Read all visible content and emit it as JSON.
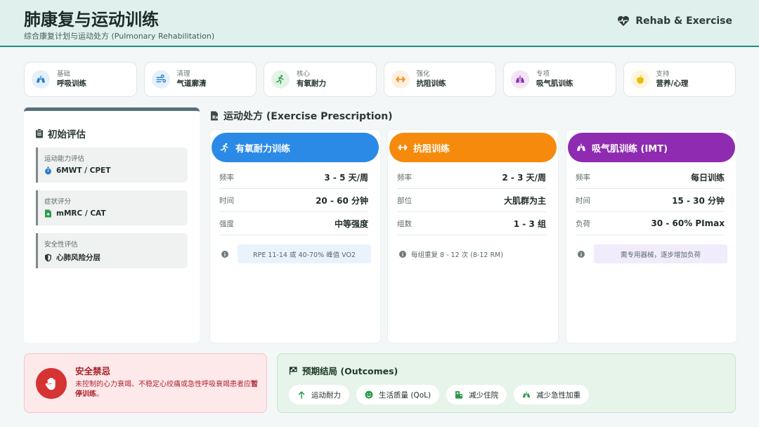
{
  "header": {
    "title": "肺康复与运动训练",
    "subtitle": "综合康复计划与运动处方 (Pulmonary Rehabilitation)",
    "brand": "Rehab & Exercise",
    "brand_icon": "heartbeat-icon"
  },
  "steps": [
    {
      "caption": "基础",
      "label": "呼吸训练",
      "icon": "lungs-icon",
      "color": "#2f80c8",
      "bg": "#e4f0fb"
    },
    {
      "caption": "清理",
      "label": "气道廓清",
      "icon": "wind-icon",
      "color": "#2f80c8",
      "bg": "#e4f0fb"
    },
    {
      "caption": "核心",
      "label": "有氧耐力",
      "icon": "running-icon",
      "color": "#2e9a4a",
      "bg": "#e3f4e6"
    },
    {
      "caption": "强化",
      "label": "抗阻训练",
      "icon": "dumbbell-icon",
      "color": "#f08a12",
      "bg": "#fdf0e0"
    },
    {
      "caption": "专项",
      "label": "吸气肌训练",
      "icon": "lungs-virus-icon",
      "color": "#8e2bb0",
      "bg": "#f3e4f8"
    },
    {
      "caption": "支持",
      "label": "营养/心理",
      "icon": "apple-icon",
      "color": "#f2b705",
      "bg": "#fdf6dc"
    }
  ],
  "assessment": {
    "title": "初始评估",
    "items": [
      {
        "caption": "运动能力评估",
        "value": "6MWT / CPET",
        "icon": "stopwatch-icon",
        "color": "#2f80c8"
      },
      {
        "caption": "症状评分",
        "value": "mMRC / CAT",
        "icon": "file-medical-icon",
        "color": "#2e9a4a"
      },
      {
        "caption": "安全性评估",
        "value": "心肺风险分层",
        "icon": "shield-icon",
        "color": "#2c3836"
      }
    ]
  },
  "prescription": {
    "title": "运动处方 (Exercise Prescription)",
    "cards": [
      {
        "title": "有氧耐力训练",
        "icon": "running-icon",
        "color": "#2a8ae6",
        "rows": [
          {
            "key": "频率",
            "value": "3 - 5 天/周"
          },
          {
            "key": "时间",
            "value": "20 - 60 分钟"
          },
          {
            "key": "强度",
            "value": "中等强度"
          }
        ],
        "note": "RPE 11-14 或 40-70% 峰值 VO2",
        "note_bg": "#eaf3fc"
      },
      {
        "title": "抗阻训练",
        "icon": "dumbbell-icon",
        "color": "#f58a0c",
        "rows": [
          {
            "key": "频率",
            "value": "2 - 3 天/周"
          },
          {
            "key": "部位",
            "value": "大肌群为主"
          },
          {
            "key": "组数",
            "value": "1 - 3 组"
          }
        ],
        "note": "每组重复 8 - 12 次 (8-12 RM)",
        "note_bg": "#ffffff"
      },
      {
        "title": "吸气肌训练 (IMT)",
        "icon": "lungs-icon",
        "color": "#8e2bb0",
        "rows": [
          {
            "key": "频率",
            "value": "每日训练"
          },
          {
            "key": "时间",
            "value": "15 - 30 分钟"
          },
          {
            "key": "负荷",
            "value": "30 - 60% PImax"
          }
        ],
        "note": "需专用器械，逐步增加负荷",
        "note_bg": "#f1ecfb"
      }
    ]
  },
  "safety": {
    "title": "安全禁忌",
    "desc_pre": "未控制的心力衰竭、不稳定心绞痛或急性呼吸衰竭患者应",
    "desc_bold": "暂停训练",
    "desc_post": "。",
    "icon": "hand-stop-icon"
  },
  "outcomes": {
    "title": "预期结局 (Outcomes)",
    "icon": "flag-icon",
    "items": [
      {
        "label": "运动耐力",
        "icon": "arrow-up-icon"
      },
      {
        "label": "生活质量 (QoL)",
        "icon": "smile-icon"
      },
      {
        "label": "减少住院",
        "icon": "hospital-icon"
      },
      {
        "label": "减少急性加重",
        "icon": "lungs-icon"
      }
    ],
    "color": "#2e9a4a"
  }
}
